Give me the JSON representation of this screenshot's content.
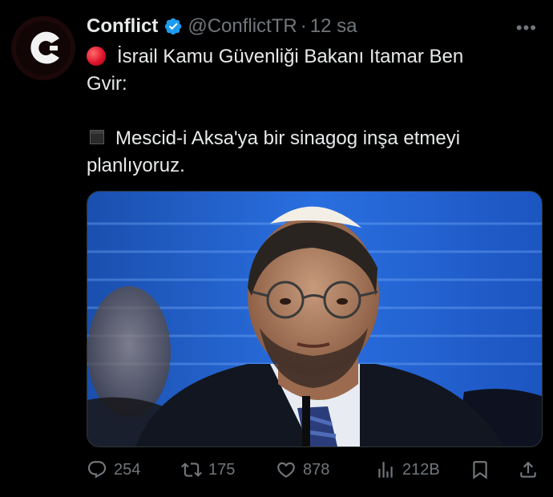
{
  "tweet": {
    "display_name": "Conflict",
    "handle": "@ConflictTR",
    "separator": "·",
    "time": "12 sa",
    "more_label": "•••",
    "text_line1": "İsrail Kamu Güvenliği Bakanı Itamar Ben",
    "text_line2": "Gvir:",
    "text_line3": "Mescid-i Aksa'ya bir sinagog inşa etmeyi",
    "text_line4": "planlıyoruz."
  },
  "actions": {
    "replies": "254",
    "reposts": "175",
    "likes": "878",
    "views": "212B"
  },
  "icons": {
    "avatar": "conflict-logo",
    "verified": "verified-badge-icon",
    "reply": "reply-icon",
    "repost": "repost-icon",
    "like": "heart-icon",
    "views": "views-icon",
    "bookmark": "bookmark-icon",
    "share": "share-icon"
  },
  "colors": {
    "background": "#000000",
    "text": "#e7e9ea",
    "muted": "#71767b",
    "verified": "#1d9bf0",
    "red_emoji": "#e0142c"
  }
}
